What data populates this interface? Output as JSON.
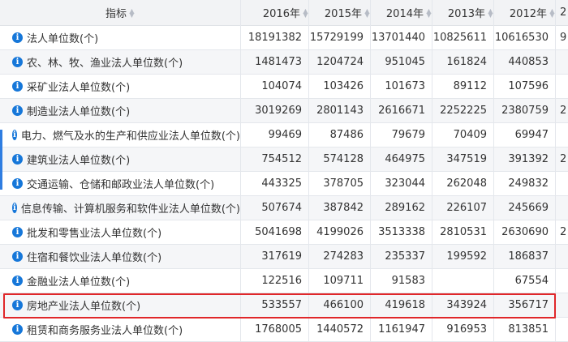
{
  "header": {
    "indicator": "指标",
    "years": [
      "2016年",
      "2015年",
      "2014年",
      "2013年",
      "2012年"
    ],
    "partial_year": "2"
  },
  "rows": [
    {
      "label": "法人单位数(个)",
      "values": [
        "18191382",
        "15729199",
        "13701440",
        "10825611",
        "10616530"
      ],
      "partial": "9"
    },
    {
      "label": "农、林、牧、渔业法人单位数(个)",
      "values": [
        "1481473",
        "1204724",
        "951045",
        "161824",
        "440853"
      ],
      "partial": ""
    },
    {
      "label": "采矿业法人单位数(个)",
      "values": [
        "104074",
        "103426",
        "101673",
        "89112",
        "107596"
      ],
      "partial": ""
    },
    {
      "label": "制造业法人单位数(个)",
      "values": [
        "3019269",
        "2801143",
        "2616671",
        "2252225",
        "2380759"
      ],
      "partial": "2"
    },
    {
      "label": "电力、燃气及水的生产和供应业法人单位数(个)",
      "values": [
        "99469",
        "87486",
        "79679",
        "70409",
        "69947"
      ],
      "partial": ""
    },
    {
      "label": "建筑业法人单位数(个)",
      "values": [
        "754512",
        "574128",
        "464975",
        "347519",
        "391392"
      ],
      "partial": "2"
    },
    {
      "label": "交通运输、仓储和邮政业法人单位数(个)",
      "values": [
        "443325",
        "378705",
        "323044",
        "262048",
        "249832"
      ],
      "partial": ""
    },
    {
      "label": "信息传输、计算机服务和软件业法人单位数(个)",
      "values": [
        "507674",
        "387842",
        "289162",
        "226107",
        "245669"
      ],
      "partial": ""
    },
    {
      "label": "批发和零售业法人单位数(个)",
      "values": [
        "5041698",
        "4199026",
        "3513338",
        "2810531",
        "2630690"
      ],
      "partial": "2"
    },
    {
      "label": "住宿和餐饮业法人单位数(个)",
      "values": [
        "317619",
        "274283",
        "235337",
        "199592",
        "186837"
      ],
      "partial": ""
    },
    {
      "label": "金融业法人单位数(个)",
      "values": [
        "122516",
        "109711",
        "91583",
        "",
        "67554"
      ],
      "partial": ""
    },
    {
      "label": "房地产业法人单位数(个)",
      "values": [
        "533557",
        "466100",
        "419618",
        "343924",
        "356717"
      ],
      "partial": ""
    },
    {
      "label": "租赁和商务服务业法人单位数(个)",
      "values": [
        "1768005",
        "1440572",
        "1161947",
        "916953",
        "813851"
      ],
      "partial": ""
    }
  ],
  "highlighted_row_label": "房地产业法人单位数(个)",
  "colors": {
    "info_icon": "#1677d9",
    "highlight_border": "#e0272a",
    "left_accent": "#2f7de1"
  }
}
